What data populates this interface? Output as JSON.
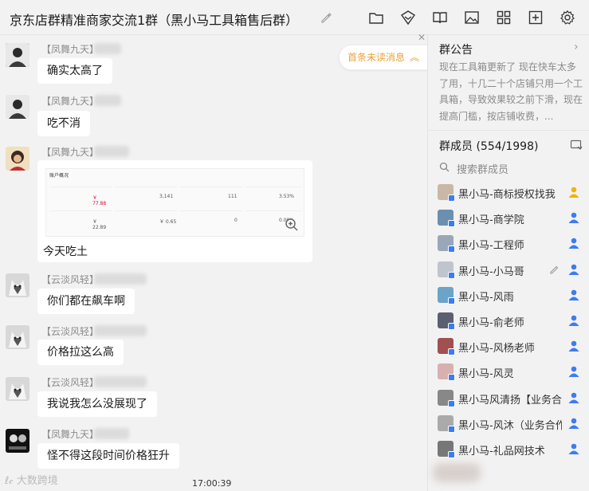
{
  "window": {
    "title": "京东店群精准商家交流1群（黑小马工具箱售后群）"
  },
  "toolbar": {
    "icons": [
      "folder-icon",
      "cube-send-icon",
      "book-icon",
      "image-icon",
      "apps-grid-icon",
      "add-square-icon",
      "gear-icon"
    ]
  },
  "chat": {
    "unread_label": "首条未读消息",
    "messages": [
      {
        "sender": "【凤舞九天】",
        "text": "确实太高了",
        "avatar": "person-dark"
      },
      {
        "sender": "【凤舞九天】",
        "text": "吃不消",
        "avatar": "person-dark"
      },
      {
        "sender": "【凤舞九天】",
        "text": "今天吃土",
        "avatar": "person-cartoon"
      },
      {
        "sender": "【云淡风轻】",
        "text": "你们都在飙车啊",
        "avatar": "husky"
      },
      {
        "sender": "【云淡风轻】",
        "text": "价格拉这么高",
        "avatar": "husky"
      },
      {
        "sender": "【云淡风轻】",
        "text": "我说我怎么没展现了",
        "avatar": "husky"
      },
      {
        "sender": "【凤舞九天】",
        "text": "怪不得这段时间价格狂升",
        "avatar": "person-bw"
      }
    ],
    "screenshot": {
      "header": "账户概况",
      "cells": [
        {
          "label": "",
          "value": "￥ 77.88",
          "red": true
        },
        {
          "label": "",
          "value": "3,141",
          "red": false
        },
        {
          "label": "",
          "value": "111",
          "red": false
        },
        {
          "label": "",
          "value": "3.53%",
          "red": false
        },
        {
          "label": "",
          "value": "￥ 22.89",
          "red": false
        },
        {
          "label": "",
          "value": "￥ 0.65",
          "red": false
        },
        {
          "label": "",
          "value": "0",
          "red": false
        },
        {
          "label": "",
          "value": "0.00%",
          "red": false
        }
      ]
    },
    "timestamp": "17:00:39",
    "watermark": "大数跨境"
  },
  "sidebar": {
    "notice_title": "群公告",
    "notice_text": "现在工具箱更新了 现在快车太多了用，十几二十个店铺只用一个工具箱，导致效果较之前下滑，现在提高门槛，按店铺收费，...",
    "members_title": "群成员 (554/1998)",
    "search_placeholder": "搜索群成员",
    "members": [
      {
        "name": "黑小马-商标授权找我",
        "role": "owner",
        "role_color": "#f0b400",
        "av": "#c9b8a8"
      },
      {
        "name": "黑小马-商学院",
        "role": "admin",
        "role_color": "#3d7cf0",
        "av": "#6b8fb0"
      },
      {
        "name": "黑小马-工程师",
        "role": "admin",
        "role_color": "#3d7cf0",
        "av": "#9aa7b8"
      },
      {
        "name": "黑小马-小马哥",
        "role": "admin",
        "role_color": "#3d7cf0",
        "av": "#c0c4cc"
      },
      {
        "name": "黑小马-风雨",
        "role": "admin",
        "role_color": "#3d7cf0",
        "av": "#6aa4c8"
      },
      {
        "name": "黑小马-俞老师",
        "role": "admin",
        "role_color": "#3d7cf0",
        "av": "#5a6070"
      },
      {
        "name": "黑小马-风杨老师",
        "role": "admin",
        "role_color": "#3d7cf0",
        "av": "#a05050"
      },
      {
        "name": "黑小马-风灵",
        "role": "admin",
        "role_color": "#3d7cf0",
        "av": "#d8b0b0"
      },
      {
        "name": "黑小马风清扬【业务合作",
        "role": "admin",
        "role_color": "#3d7cf0",
        "av": "#888"
      },
      {
        "name": "黑小马-风沐（业务合作",
        "role": "admin",
        "role_color": "#3d7cf0",
        "av": "#aaa"
      },
      {
        "name": "黑小马-礼品网技术",
        "role": "admin",
        "role_color": "#3d7cf0",
        "av": "#777"
      }
    ]
  }
}
